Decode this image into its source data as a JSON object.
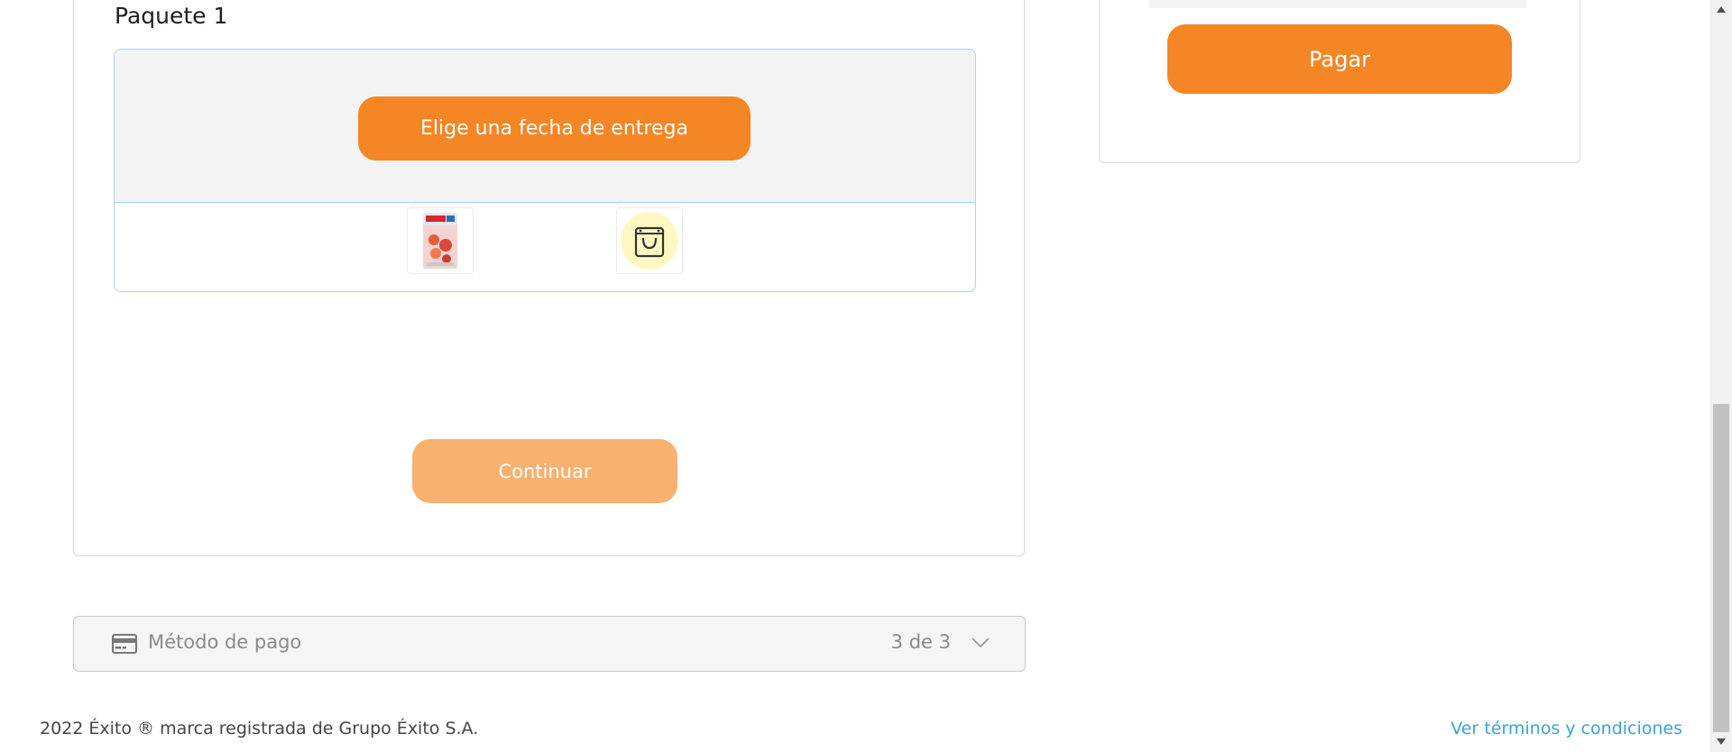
{
  "package": {
    "title": "Paquete 1",
    "date_button_label": "Elige una fecha de entrega",
    "products": [
      {
        "icon": "product-image-icon",
        "description": "snack package"
      },
      {
        "icon": "shopping-bag-icon"
      }
    ]
  },
  "continue_label": "Continuar",
  "summary": {
    "pay_label": "Pagar"
  },
  "payment": {
    "icon": "credit-card-icon",
    "label": "Método de pago",
    "step": "3 de 3",
    "toggle_icon": "chevron-down-icon"
  },
  "footer": {
    "copyright": "2022 Éxito ® marca registrada de Grupo Éxito S.A.",
    "terms_link": "Ver términos y condiciones"
  },
  "colors": {
    "brand_orange": "#f58625",
    "disabled_orange": "#f9b170",
    "link_blue": "#3ba3d4",
    "package_border": "#a9d3ec"
  }
}
